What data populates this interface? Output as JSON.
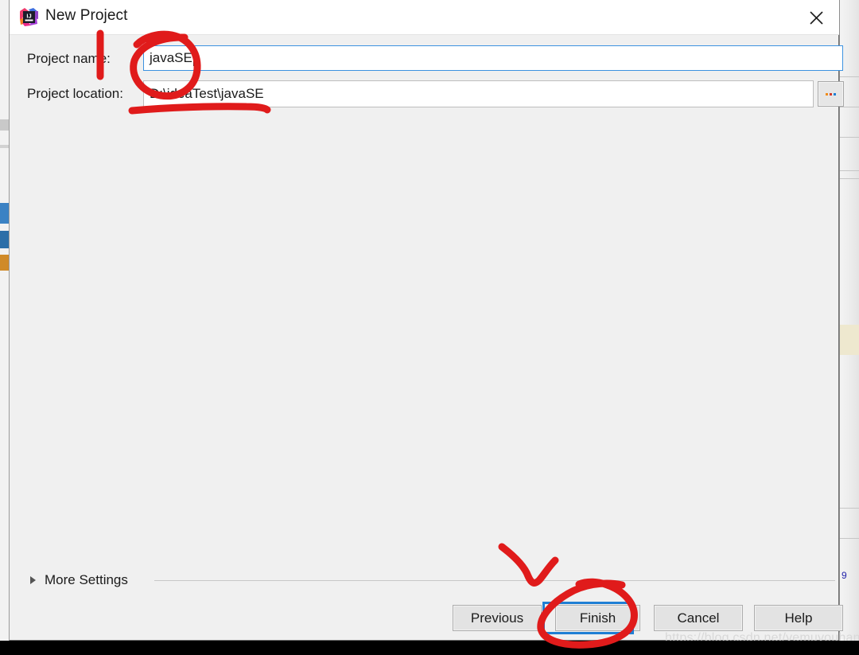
{
  "window": {
    "title": "New Project",
    "app_icon": "intellij-idea-icon",
    "close_icon": "close-icon"
  },
  "form": {
    "project_name": {
      "label": "Project name:",
      "value": "javaSE",
      "placeholder": ""
    },
    "project_location": {
      "label": "Project location:",
      "value": "D:\\ideaTest\\javaSE",
      "placeholder": "",
      "browse_label": "..."
    }
  },
  "more_settings": {
    "label": "More Settings",
    "expanded": false,
    "arrow_icon": "chevron-right-icon"
  },
  "footer": {
    "previous_label": "Previous",
    "finish_label": "Finish",
    "cancel_label": "Cancel",
    "help_label": "Help",
    "focused_button": "Finish"
  },
  "watermark": {
    "text": "https://blog.csdn.net/yemuyouhan"
  },
  "annotations": {
    "color": "#e01b1b",
    "marks": [
      "vertical-stroke-over-project-name-label",
      "circle-around-project-name-input",
      "underline-under-project-location",
      "arrow-squiggle-above-finish",
      "circle-around-finish-button"
    ]
  },
  "colors": {
    "dialog_background": "#f0f0f0",
    "titlebar_background": "#ffffff",
    "input_background": "#ffffff",
    "focus_blue": "#1f7fd4",
    "input_focus_border": "#3c92e0",
    "button_face": "#e3e3e3",
    "annotation_red": "#e01b1b",
    "bottom_bar": "#000000"
  },
  "background_editor": {
    "highlight": "#eee8cf"
  }
}
